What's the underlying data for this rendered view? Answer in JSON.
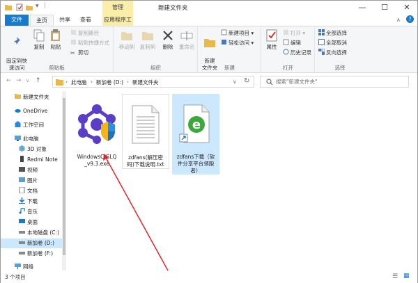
{
  "window": {
    "title": "新建文件夹",
    "context_tab": "管理",
    "controls": {
      "minimize": "—",
      "maximize": "☐",
      "close": "✕"
    }
  },
  "tabs": {
    "file": "文件",
    "home": "主页",
    "share": "共享",
    "view": "查看",
    "apptools": "应用程序工具"
  },
  "ribbon": {
    "clipboard": {
      "label": "剪贴板",
      "pin": "固定到快\n速访问",
      "copy": "复制",
      "paste": "粘贴",
      "copy_path": "复制路径",
      "paste_shortcut": "粘贴快捷方式",
      "cut": "剪切"
    },
    "organize": {
      "label": "组织",
      "move_to": "移动到",
      "copy_to": "复制到",
      "delete": "删除",
      "rename": "重命名"
    },
    "new": {
      "label": "新建",
      "new_folder": "新建\n文件夹",
      "new_item": "新建项目",
      "easy_access": "轻松访问"
    },
    "open": {
      "label": "打开",
      "properties": "属性",
      "open": "打开",
      "edit": "编辑",
      "history": "历史记录"
    },
    "select": {
      "label": "选择",
      "select_all": "全部选择",
      "select_none": "全部取消",
      "invert": "反向选择"
    }
  },
  "address": {
    "crumbs": [
      "此电脑",
      "新加卷 (D:)",
      "新建文件夹"
    ],
    "search_placeholder": "搜索\"新建文件夹\""
  },
  "nav": {
    "items": [
      "新建文件夹",
      "OneDrive",
      "工作空间",
      "此电脑",
      "3D 对象",
      "Redmi Note",
      "视频",
      "图片",
      "文档",
      "下载",
      "音乐",
      "桌面",
      "本地磁盘 (C:)",
      "新加卷 (D:)",
      "新加卷 (F:)",
      "网络"
    ]
  },
  "files": [
    {
      "name": "WindowsCJGLQ\n_v9.3.exe",
      "icon": "exe-shield-icon"
    },
    {
      "name": "zdfans(解压密\n码)下载说明.txt",
      "icon": "text-file-icon"
    },
    {
      "name": "zdfans下载（软\n件分享平台领跑\n者）",
      "icon": "ie-shortcut-icon"
    }
  ],
  "status": {
    "text": "3 个项目"
  },
  "colors": {
    "accent": "#1979ca",
    "context_tab": "#fbeea8",
    "selection": "#cce8ff",
    "arrow": "#e0262b"
  }
}
